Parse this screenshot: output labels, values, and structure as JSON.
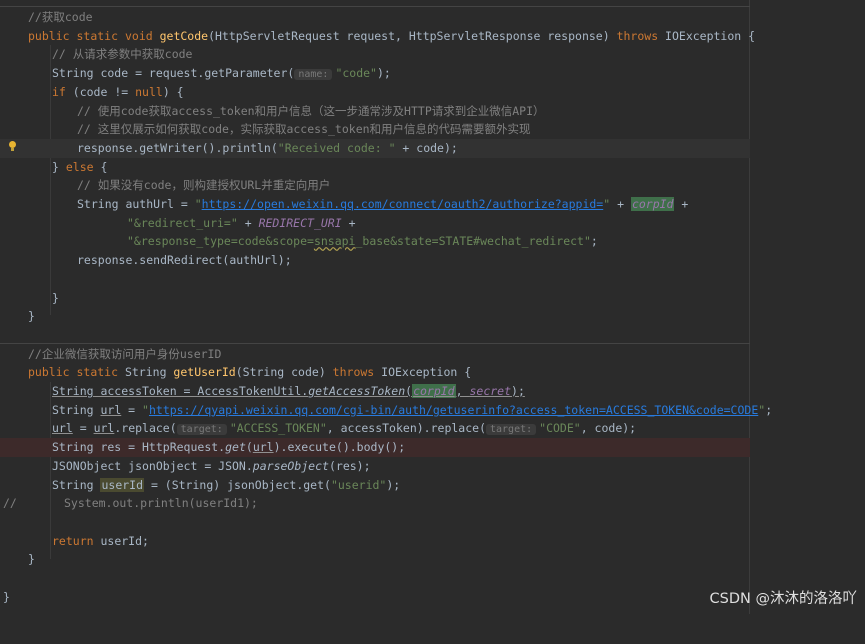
{
  "colors": {
    "background": "#2b2b2b",
    "keyword": "#cc7832",
    "function": "#ffc66d",
    "string": "#6a8759",
    "comment": "#808080",
    "field": "#9876aa",
    "text": "#a9b7c6"
  },
  "icons": {
    "intention": "lightbulb-icon"
  },
  "method1": {
    "comment_title": "//获取code",
    "sig_public": "public",
    "sig_static": "static",
    "sig_void": "void",
    "sig_name": "getCode",
    "sig_params": "(HttpServletRequest request, HttpServletResponse response) ",
    "sig_throws": "throws",
    "sig_exception": " IOException {",
    "c1": "// 从请求参数中获取code",
    "l2_a": "String code = request.getParameter(",
    "l2_hint": "name:",
    "l2_str": "\"code\"",
    "l2_b": ");",
    "l3_if": "if",
    "l3_a": " (code != ",
    "l3_null": "null",
    "l3_b": ") {",
    "c2": "// 使用code获取access_token和用户信息（这一步通常涉及HTTP请求到企业微信API）",
    "c3": "// 这里仅展示如何获取code，实际获取access_token和用户信息的代码需要额外实现",
    "l6_a": "response.getWriter().println(",
    "l6_str": "\"Received code: \"",
    "l6_b": " + code);",
    "l7_a": "} ",
    "l7_else": "else",
    "l7_b": " {",
    "c4": "// 如果没有code，则构建授权URL并重定向用户",
    "l9_a": "String authUrl = ",
    "l9_q1": "\"",
    "l9_url": "https://open.weixin.qq.com/connect/oauth2/authorize?appid=",
    "l9_q2": "\"",
    "l9_plus": " + ",
    "l9_field": "corpId",
    "l9_end": " +",
    "l10_str": "\"&redirect_uri=\"",
    "l10_plus": " + ",
    "l10_field": "REDIRECT_URI",
    "l10_end": " +",
    "l11_s1": "\"&response_type=code&scope=",
    "l11_wavy": "snsapi",
    "l11_s2": "_base&state=STATE#wechat_redirect\"",
    "l11_end": ";",
    "l12": "response.sendRedirect(authUrl);",
    "close_inner": "}",
    "close_outer": "}"
  },
  "method2": {
    "comment_title": "//企业微信获取访问用户身份userID",
    "sig_public": "public",
    "sig_static": "static",
    "sig_type": " String ",
    "sig_name": "getUserId",
    "sig_params": "(String code) ",
    "sig_throws": "throws",
    "sig_exception": " IOException {",
    "l1_decl": "String accessToken = AccessTokenUtil.",
    "l1_call": "getAccessToken",
    "l1_open": "(",
    "l1_arg1": "corpId",
    "l1_comma": ", ",
    "l1_arg2": "secret",
    "l1_close": ");",
    "l2_a": "String ",
    "l2_var": "url",
    "l2_b": " = ",
    "l2_q1": "\"",
    "l2_url": "https://qyapi.weixin.qq.com/cgi-bin/auth/getuserinfo?access_token=ACCESS_TOKEN&code=CODE",
    "l2_q2": "\"",
    "l2_end": ";",
    "l3_var1": "url",
    "l3_a": " = ",
    "l3_var2": "url",
    "l3_b": ".replace(",
    "l3_hint1": "target:",
    "l3_str1": "\"ACCESS_TOKEN\"",
    "l3_c": ", accessToken).replace(",
    "l3_hint2": "target:",
    "l3_str2": "\"CODE\"",
    "l3_d": ", code);",
    "l4_a": "String res = HttpRequest.",
    "l4_get": "get",
    "l4_b": "(",
    "l4_var": "url",
    "l4_c": ").execute().body();",
    "l5_a": "JSONObject jsonObject = JSON.",
    "l5_call": "parseObject",
    "l5_b": "(res);",
    "l6_a": "String ",
    "l6_var": "userId",
    "l6_b": " = (String) jsonObject.get(",
    "l6_str": "\"userid\"",
    "l6_c": ");",
    "l7_prefix": "//",
    "l7_code": "System.out.println(userId1);",
    "l8_return": "return",
    "l8_rest": " userId;",
    "close": "}"
  },
  "final_close": "}",
  "watermark": "CSDN @沐沐的洛洛吖"
}
